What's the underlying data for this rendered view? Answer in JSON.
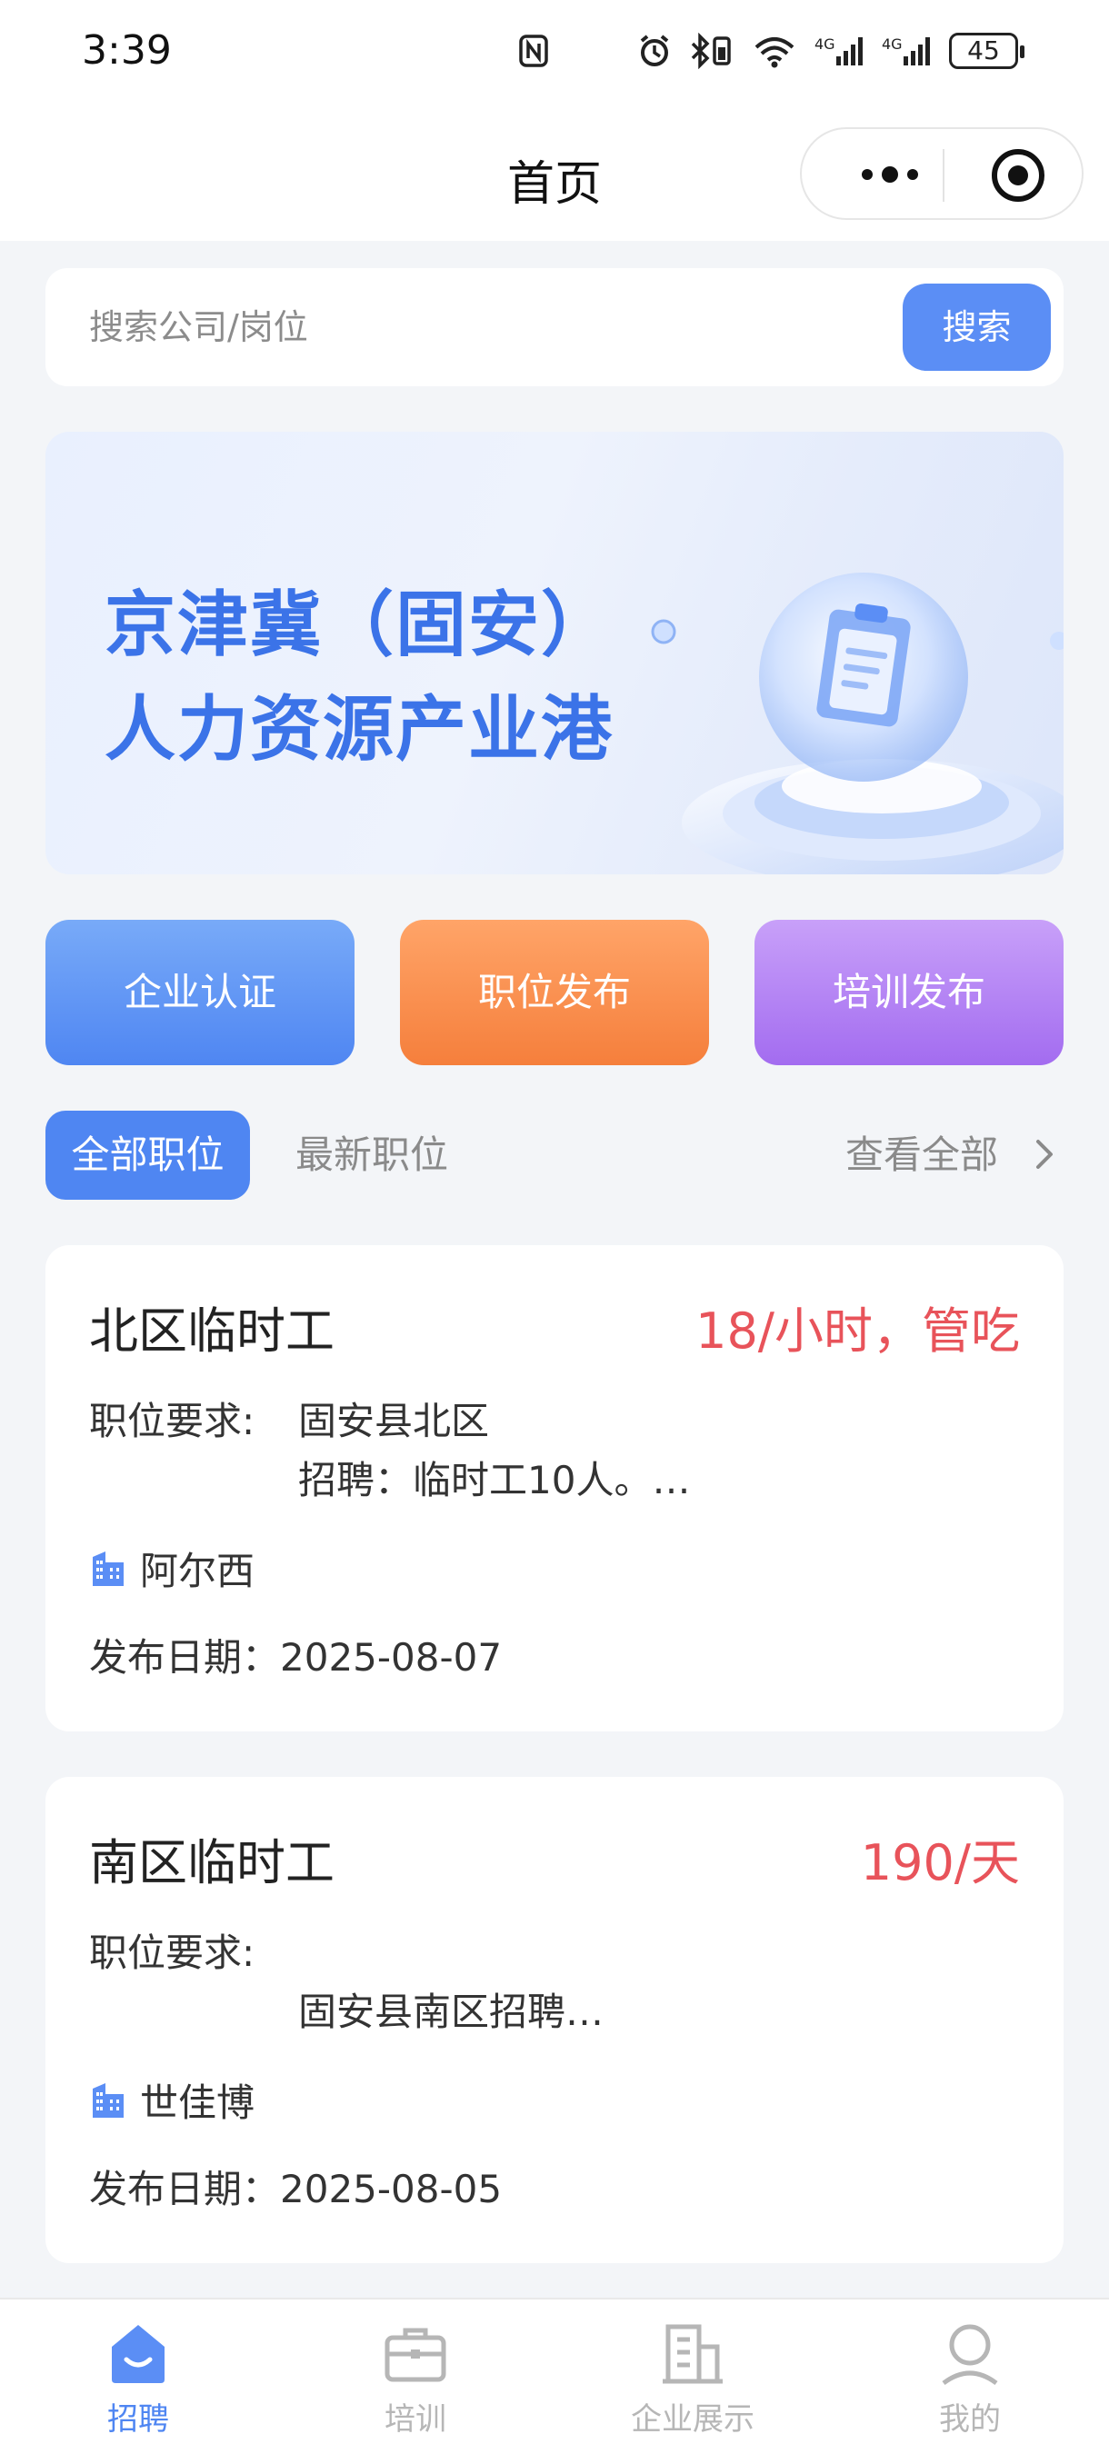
{
  "status_bar": {
    "time": "3:39",
    "battery": "45",
    "network": "4G"
  },
  "nav": {
    "title": "首页"
  },
  "search": {
    "placeholder": "搜索公司/岗位",
    "button": "搜索"
  },
  "banner": {
    "line1": "京津冀（固安）",
    "line2": "人力资源产业港"
  },
  "quick_actions": [
    "企业认证",
    "职位发布",
    "培训发布"
  ],
  "tabs": {
    "all": "全部职位",
    "latest": "最新职位",
    "view_all": "查看全部"
  },
  "jobs": [
    {
      "title": "北区临时工",
      "salary": "18/小时，管吃",
      "req_label": "职位要求:",
      "req_line1": "固安县北区",
      "req_line2": "招聘：临时工10人。…",
      "company": "阿尔西",
      "date": "发布日期：2025-08-07"
    },
    {
      "title": "南区临时工",
      "salary": "190/天",
      "req_label": "职位要求:",
      "req_line1": "",
      "req_line2": "固安县南区招聘…",
      "company": "世佳博",
      "date": "发布日期：2025-08-05"
    }
  ],
  "tabbar": [
    {
      "label": "招聘",
      "icon": "recruit-icon",
      "active": true
    },
    {
      "label": "培训",
      "icon": "briefcase-icon",
      "active": false
    },
    {
      "label": "企业展示",
      "icon": "building-icon",
      "active": false
    },
    {
      "label": "我的",
      "icon": "user-icon",
      "active": false
    }
  ],
  "colors": {
    "primary": "#4f86f2",
    "salary": "#e8535a",
    "orange": "#f57f3c",
    "purple": "#a36cf0",
    "banner_text": "#3b73e8"
  }
}
